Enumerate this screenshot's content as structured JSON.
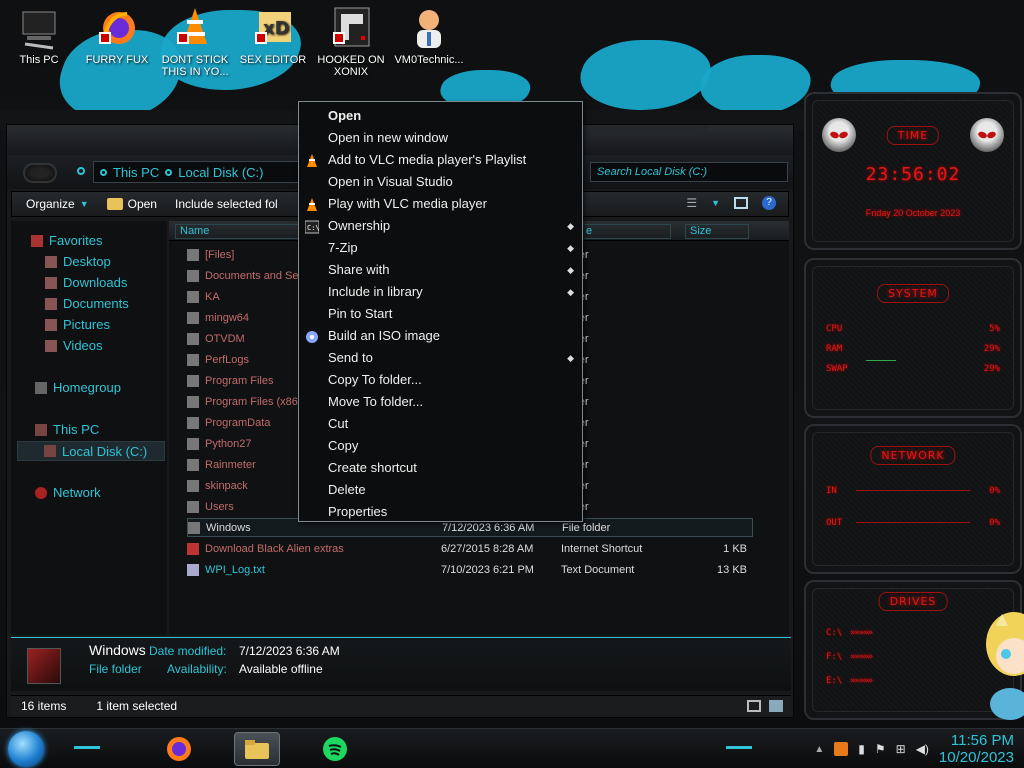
{
  "desktop": {
    "icons": [
      {
        "label": "This PC",
        "icon": "computer-icon"
      },
      {
        "label": "FURRY FUX",
        "icon": "firefox-icon"
      },
      {
        "label": "DONT STICK THIS IN YO...",
        "icon": "vlc-cone-icon"
      },
      {
        "label": "SEX EDITOR",
        "icon": "xd-editor-icon"
      },
      {
        "label": "HOOKED ON XONIX",
        "icon": "game-icon"
      },
      {
        "label": "VM0Technic...",
        "icon": "doctor-avatar-icon"
      }
    ]
  },
  "explorer": {
    "address": {
      "segments": [
        "This PC",
        "Local Disk (C:)"
      ]
    },
    "search_placeholder": "Search Local Disk (C:)",
    "toolbar": {
      "organize": "Organize",
      "open": "Open",
      "include": "Include selected fol"
    },
    "nav": {
      "favorites": "Favorites",
      "desktop": "Desktop",
      "downloads": "Downloads",
      "documents": "Documents",
      "pictures": "Pictures",
      "videos": "Videos",
      "homegroup": "Homegroup",
      "this_pc": "This PC",
      "local_disk": "Local Disk (C:)",
      "network": "Network"
    },
    "columns": {
      "name": "Name",
      "type": "e",
      "size": "Size"
    },
    "files": [
      {
        "name": "[Files]",
        "date": "",
        "type": "folder",
        "size": ""
      },
      {
        "name": "Documents and Se",
        "date": "",
        "type": "folder",
        "size": ""
      },
      {
        "name": "KA",
        "date": "",
        "type": "folder",
        "size": ""
      },
      {
        "name": "mingw64",
        "date": "",
        "type": "folder",
        "size": ""
      },
      {
        "name": "OTVDM",
        "date": "",
        "type": "folder",
        "size": ""
      },
      {
        "name": "PerfLogs",
        "date": "",
        "type": "folder",
        "size": ""
      },
      {
        "name": "Program Files",
        "date": "",
        "type": "folder",
        "size": ""
      },
      {
        "name": "Program Files (x86",
        "date": "",
        "type": "folder",
        "size": ""
      },
      {
        "name": "ProgramData",
        "date": "",
        "type": "folder",
        "size": ""
      },
      {
        "name": "Python27",
        "date": "",
        "type": "folder",
        "size": ""
      },
      {
        "name": "Rainmeter",
        "date": "",
        "type": "folder",
        "size": ""
      },
      {
        "name": "skinpack",
        "date": "",
        "type": "folder",
        "size": ""
      },
      {
        "name": "Users",
        "date": "",
        "type": "folder",
        "size": ""
      },
      {
        "name": "Windows",
        "date": "7/12/2023 6:36 AM",
        "type": "File folder",
        "size": ""
      },
      {
        "name": "Download Black Alien extras",
        "date": "6/27/2015 8:28 AM",
        "type": "Internet Shortcut",
        "size": "1 KB"
      },
      {
        "name": "WPI_Log.txt",
        "date": "7/10/2023 6:21 PM",
        "type": "Text Document",
        "size": "13 KB"
      }
    ],
    "details": {
      "name": "Windows",
      "date_label": "Date modified:",
      "date_value": "7/12/2023 6:36 AM",
      "type": "File folder",
      "avail_label": "Availability:",
      "avail_value": "Available offline"
    },
    "status": {
      "count": "16 items",
      "selected": "1 item selected"
    }
  },
  "context_menu": {
    "items": [
      {
        "label": "Open",
        "bold": true,
        "icon": "",
        "submenu": false
      },
      {
        "label": "Open in new window",
        "icon": "",
        "submenu": false
      },
      {
        "label": "Add to VLC media player's Playlist",
        "icon": "vlc-cone-icon",
        "submenu": false
      },
      {
        "label": "Open in Visual Studio",
        "icon": "",
        "submenu": false
      },
      {
        "label": "Play with VLC media player",
        "icon": "vlc-cone-icon",
        "submenu": false
      },
      {
        "label": "Ownership",
        "icon": "cmd-icon",
        "submenu": true
      },
      {
        "label": "7-Zip",
        "icon": "",
        "submenu": true
      },
      {
        "label": "Share with",
        "icon": "",
        "submenu": true
      },
      {
        "label": "Include in library",
        "icon": "",
        "submenu": true
      },
      {
        "label": "Pin to Start",
        "icon": "",
        "submenu": false
      },
      {
        "label": "Build an ISO image",
        "icon": "disc-icon",
        "submenu": false
      },
      {
        "label": "Send to",
        "icon": "",
        "submenu": true
      },
      {
        "label": "Copy To folder...",
        "icon": "",
        "submenu": false
      },
      {
        "label": "Move To folder...",
        "icon": "",
        "submenu": false
      },
      {
        "label": "Cut",
        "icon": "",
        "submenu": false
      },
      {
        "label": "Copy",
        "icon": "",
        "submenu": false
      },
      {
        "label": "Create shortcut",
        "icon": "",
        "submenu": false
      },
      {
        "label": "Delete",
        "icon": "",
        "submenu": false
      },
      {
        "label": "Properties",
        "icon": "",
        "submenu": false
      }
    ]
  },
  "widgets": {
    "time": {
      "title": "TIME",
      "clock": "23:56:02",
      "date": "Friday 20 October 2023"
    },
    "system": {
      "title": "SYSTEM",
      "cpu_label": "CPU",
      "cpu": "5%",
      "ram_label": "RAM",
      "ram": "29%",
      "swap_label": "SWAP",
      "swap": "29%"
    },
    "network": {
      "title": "NETWORK",
      "in_label": "IN",
      "in": "0%",
      "out_label": "OUT",
      "out": "0%"
    },
    "drives": {
      "title": "DRIVES",
      "d1": "C:\\",
      "d2": "F:\\",
      "d2_val": "10",
      "d3": "E:\\"
    }
  },
  "taskbar": {
    "apps": [
      "firefox-icon",
      "file-explorer-icon",
      "spotify-icon"
    ],
    "time": "11:56 PM",
    "date": "10/20/2023"
  },
  "colors": {
    "accent": "#2ec4d6",
    "widget_red": "#e01818",
    "folder_name": "#c36b6b"
  }
}
